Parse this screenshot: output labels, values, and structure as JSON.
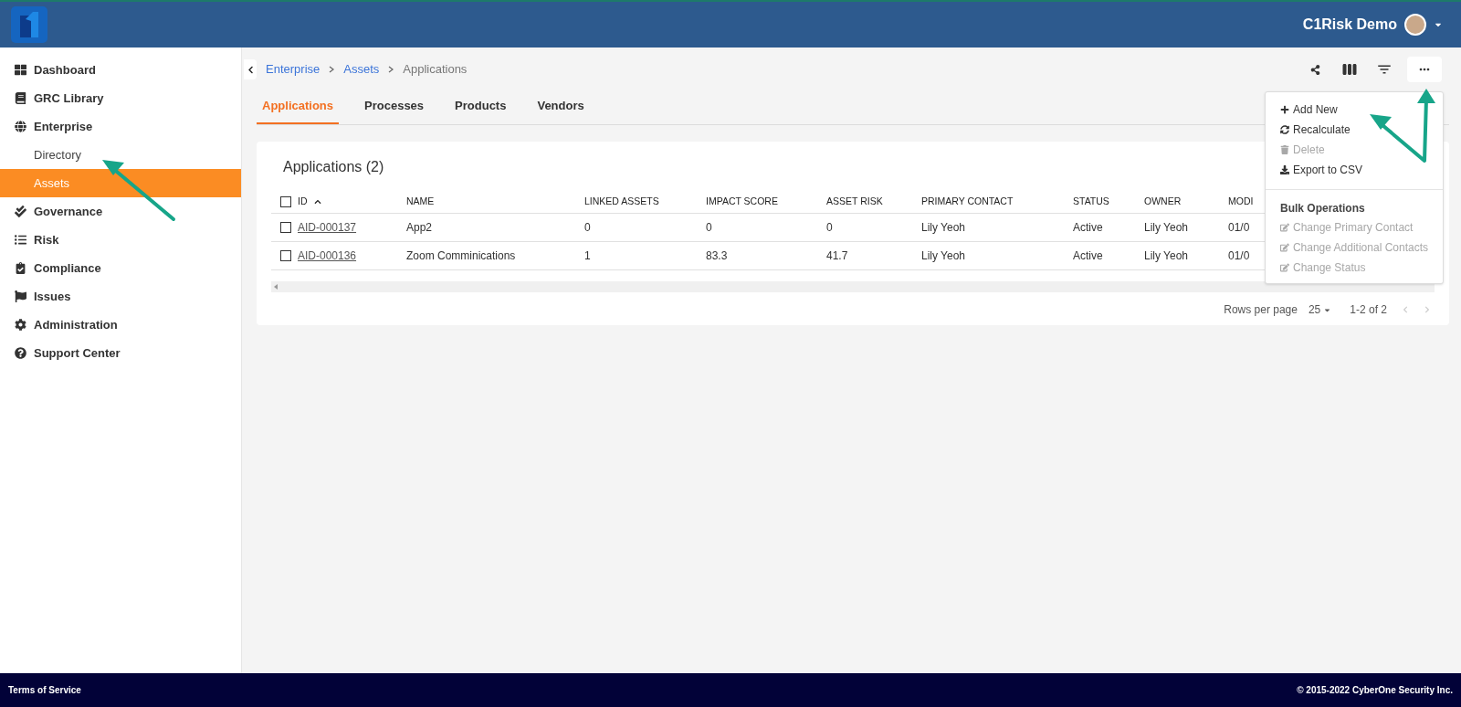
{
  "header": {
    "user_name": "C1Risk Demo"
  },
  "sidebar": {
    "items": [
      {
        "label": "Dashboard",
        "selected": false
      },
      {
        "label": "GRC Library",
        "selected": false
      },
      {
        "label": "Enterprise",
        "selected": false,
        "children": [
          {
            "label": "Directory",
            "selected": false
          },
          {
            "label": "Assets",
            "selected": true
          }
        ]
      },
      {
        "label": "Governance",
        "selected": false
      },
      {
        "label": "Risk",
        "selected": false
      },
      {
        "label": "Compliance",
        "selected": false
      },
      {
        "label": "Issues",
        "selected": false
      },
      {
        "label": "Administration",
        "selected": false
      },
      {
        "label": "Support Center",
        "selected": false
      }
    ]
  },
  "breadcrumb": [
    {
      "label": "Enterprise",
      "link": true
    },
    {
      "label": "Assets",
      "link": true
    },
    {
      "label": "Applications",
      "link": false
    }
  ],
  "tabs": [
    {
      "label": "Applications",
      "selected": true
    },
    {
      "label": "Processes",
      "selected": false
    },
    {
      "label": "Products",
      "selected": false
    },
    {
      "label": "Vendors",
      "selected": false
    }
  ],
  "card": {
    "title": "Applications (2)",
    "table": {
      "header_checked": false,
      "columns": [
        "ID",
        "NAME",
        "LINKED ASSETS",
        "IMPACT SCORE",
        "ASSET RISK",
        "PRIMARY CONTACT",
        "STATUS",
        "OWNER",
        "MODI"
      ],
      "rows": [
        {
          "checked": false,
          "cells": [
            "AID-000137",
            "App2",
            "0",
            "0",
            "0",
            "Lily Yeoh",
            "Active",
            "Lily Yeoh",
            "01/0"
          ]
        },
        {
          "checked": false,
          "cells": [
            "AID-000136",
            "Zoom Comminications",
            "1",
            "83.3",
            "41.7",
            "Lily Yeoh",
            "Active",
            "Lily Yeoh",
            "01/0"
          ]
        }
      ]
    },
    "pagination": {
      "rows_per_page_label": "Rows per page",
      "rows_per_page": "25",
      "range": "1-2 of 2"
    }
  },
  "menu": {
    "actions": [
      {
        "label": "Add New",
        "disabled": false
      },
      {
        "label": "Recalculate",
        "disabled": false
      },
      {
        "label": "Delete",
        "disabled": true
      },
      {
        "label": "Export to CSV",
        "disabled": false
      }
    ],
    "section": {
      "title": "Bulk Operations",
      "items": [
        {
          "label": "Change Primary Contact",
          "disabled": true
        },
        {
          "label": "Change Additional Contacts",
          "disabled": true
        },
        {
          "label": "Change Status",
          "disabled": true
        }
      ]
    }
  },
  "footer": {
    "left": "Terms of Service",
    "right": "© 2015-2022 CyberOne Security Inc."
  }
}
